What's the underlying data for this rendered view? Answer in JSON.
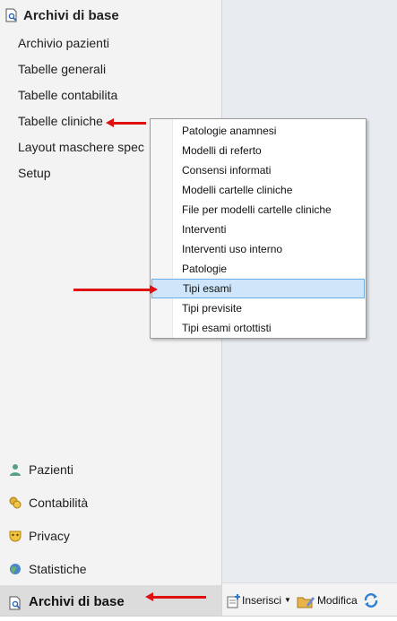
{
  "sidebar": {
    "header": {
      "title": "Archivi di base",
      "icon": "document-search-icon"
    },
    "items": [
      {
        "label": "Archivio pazienti"
      },
      {
        "label": "Tabelle generali"
      },
      {
        "label": "Tabelle contabilita"
      },
      {
        "label": "Tabelle cliniche"
      },
      {
        "label": "Layout maschere spec"
      },
      {
        "label": "Setup"
      }
    ]
  },
  "popup_menu": {
    "items": [
      {
        "label": "Patologie anamnesi"
      },
      {
        "label": "Modelli di referto"
      },
      {
        "label": "Consensi informati"
      },
      {
        "label": "Modelli cartelle cliniche"
      },
      {
        "label": "File per modelli cartelle cliniche"
      },
      {
        "label": "Interventi"
      },
      {
        "label": "Interventi uso interno"
      },
      {
        "label": "Patologie"
      },
      {
        "label": "Tipi esami",
        "selected": true
      },
      {
        "label": "Tipi previsite"
      },
      {
        "label": "Tipi esami ortottisti"
      }
    ]
  },
  "bottom_nav": {
    "items": [
      {
        "label": "Pazienti",
        "icon": "person-icon"
      },
      {
        "label": "Contabilità",
        "icon": "coins-icon"
      },
      {
        "label": "Privacy",
        "icon": "mask-icon"
      },
      {
        "label": "Statistiche",
        "icon": "globe-icon"
      },
      {
        "label": "Archivi di base",
        "icon": "document-search-icon",
        "active": true
      }
    ]
  },
  "toolbar": {
    "insert_label": "Inserisci",
    "edit_label": "Modifica"
  },
  "colors": {
    "arrow": "#e01010",
    "selection_bg": "#cfe6fa",
    "selection_border": "#6aaee8"
  }
}
